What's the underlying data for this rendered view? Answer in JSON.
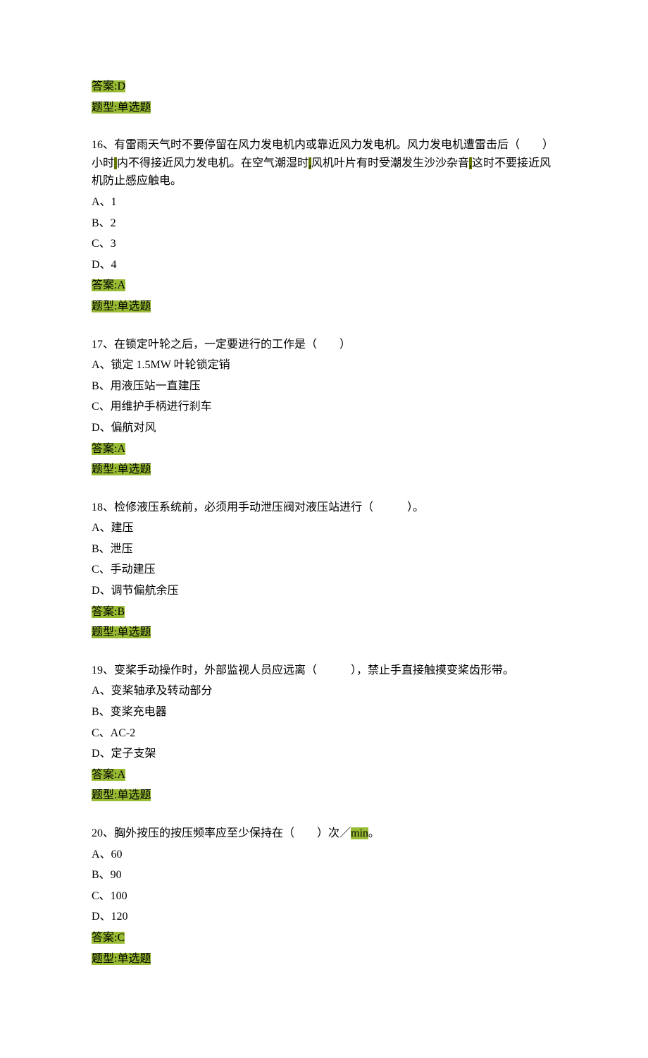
{
  "top": {
    "answer_prefix": "答案:",
    "answer_value": "D",
    "type_label": "题型:单选题"
  },
  "questions": [
    {
      "num": "16",
      "stem_parts": [
        "16、有雷雨天气时不要停留在风力发电机内或靠近风力发电机。风力发电机遭雷击后（　　）小时",
        "内不得接近风力发电机。在空气潮湿时",
        "风机叶片有时受潮发生沙沙杂音",
        "这时不要接近风机防止感应触电。"
      ],
      "options": [
        "A、1",
        "B、2",
        "C、3",
        "D、4"
      ],
      "answer_prefix": "答案:",
      "answer_value": "A",
      "type_label": "题型:单选题"
    },
    {
      "num": "17",
      "stem": "17、在锁定叶轮之后，一定要进行的工作是（　　）",
      "options": [
        "A、锁定 1.5MW 叶轮锁定销",
        "B、用液压站一直建压",
        "C、用维护手柄进行刹车",
        "D、偏航对风"
      ],
      "answer_prefix": "答案:",
      "answer_value": "A",
      "type_label": "题型:单选题"
    },
    {
      "num": "18",
      "stem": "18、检修液压系统前，必须用手动泄压阀对液压站进行（　　　）。",
      "options": [
        "A、建压",
        "B、泄压",
        "C、手动建压",
        "D、调节偏航余压"
      ],
      "answer_prefix": "答案:",
      "answer_value": "B",
      "type_label": "题型:单选题"
    },
    {
      "num": "19",
      "stem": "19、变桨手动操作时，外部监视人员应远离（　　　），禁止手直接触摸变桨齿形带。",
      "options": [
        "A、变桨轴承及转动部分",
        "B、变桨充电器",
        "C、AC-2",
        "D、定子支架"
      ],
      "answer_prefix": "答案:",
      "answer_value": "A",
      "type_label": "题型:单选题"
    },
    {
      "num": "20",
      "stem_parts": [
        "20、胸外按压的按压频率应至少保持在（　　）次／",
        "min",
        "。"
      ],
      "options": [
        "A、60",
        "B、90",
        "C、100",
        "D、120"
      ],
      "answer_prefix": "答案:",
      "answer_value": "C",
      "type_label": "题型:单选题"
    }
  ]
}
